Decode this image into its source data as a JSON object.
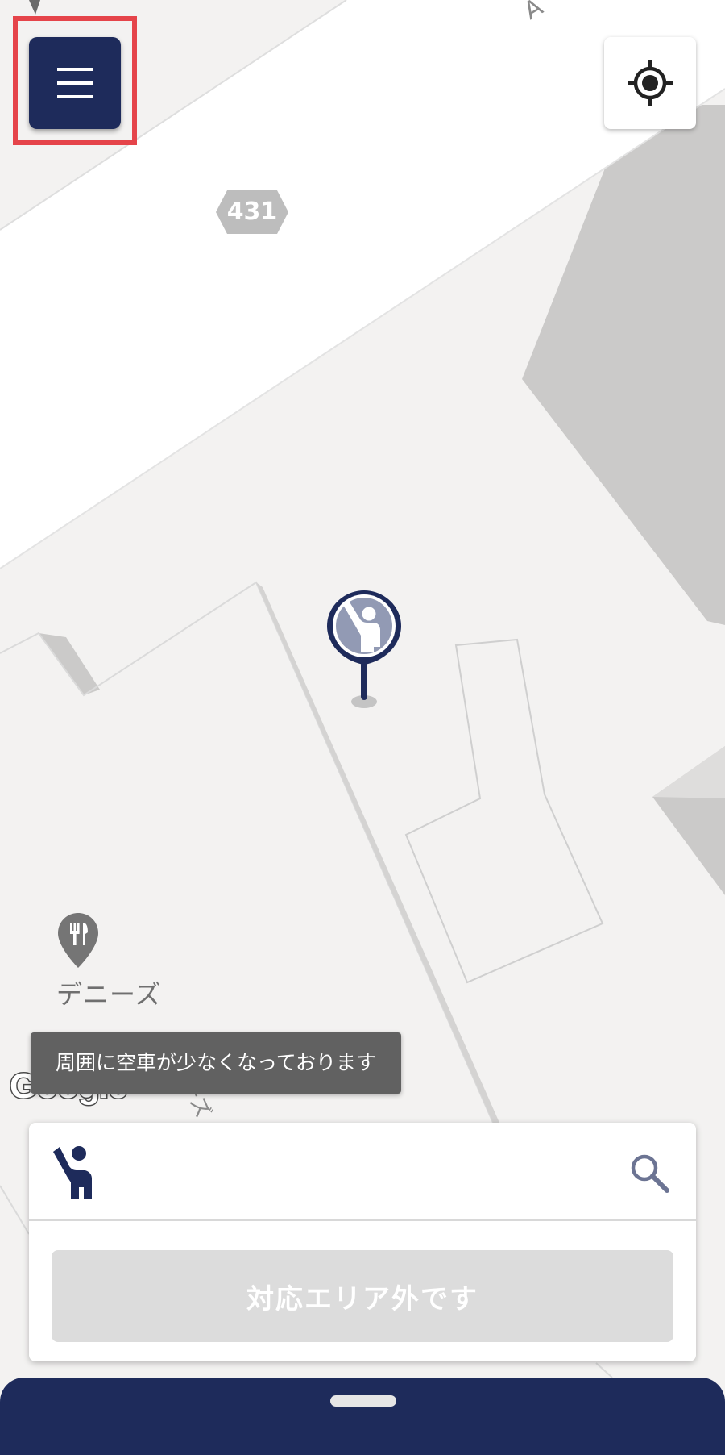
{
  "map": {
    "route_number": "431",
    "road_label_top": "A",
    "road_label_bottom": "ーズ",
    "poi": {
      "name": "デニーズ",
      "icon": "restaurant-icon"
    },
    "attribution": "Google"
  },
  "controls": {
    "menu_icon": "hamburger-menu-icon",
    "locate_icon": "my-location-icon",
    "highlight_color": "#e5444a"
  },
  "pickup_pin": {
    "icon": "hailing-passenger-icon"
  },
  "toast": {
    "message": "周囲に空車が少なくなっております"
  },
  "booking_card": {
    "destination_value": "",
    "request_button_label": "対応エリア外です",
    "request_button_enabled": false
  },
  "colors": {
    "brand_navy": "#1e2b5b",
    "disabled_gray": "#dcdcdc",
    "map_background": "#f3f2f1"
  }
}
